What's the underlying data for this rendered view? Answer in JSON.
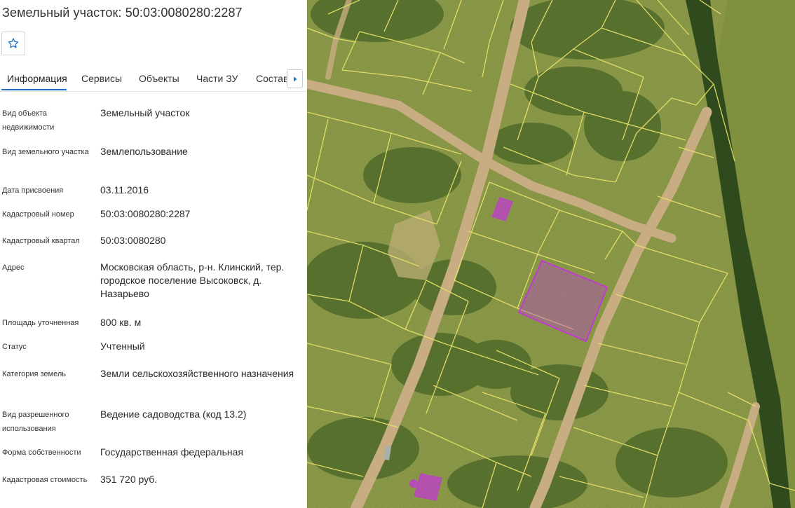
{
  "title": "Земельный участок: 50:03:0080280:2287",
  "favorite": {
    "icon": "star-outline-icon"
  },
  "tabs": [
    {
      "label": "Информация",
      "active": true
    },
    {
      "label": "Сервисы",
      "active": false
    },
    {
      "label": "Объекты",
      "active": false
    },
    {
      "label": "Части ЗУ",
      "active": false
    },
    {
      "label": "Составы",
      "active": false
    }
  ],
  "tab_scroll_icon": "caret-right-icon",
  "fields": [
    {
      "label": "Вид объекта недвижимости",
      "value": "Земельный участок"
    },
    {
      "label": "Вид земельного участка",
      "value": "Землепользование"
    },
    {
      "label": "Дата присвоения",
      "value": "03.11.2016"
    },
    {
      "label": "Кадастровый номер",
      "value": "50:03:0080280:2287"
    },
    {
      "label": "Кадастровый квартал",
      "value": "50:03:0080280"
    },
    {
      "label": "Адрес",
      "value": "Московская область, р-н. Клинский, тер. городское поселение Высоковск, д. Назарьево"
    },
    {
      "label": "Площадь уточненная",
      "value": "800 кв. м"
    },
    {
      "label": "Статус",
      "value": "Учтенный"
    },
    {
      "label": "Категория земель",
      "value": "Земли сельскохозяйственного назначения"
    },
    {
      "label": "Вид разрешенного использования",
      "value": "Ведение садоводства (код 13.2)"
    },
    {
      "label": "Форма собственности",
      "value": "Государственная федеральная"
    },
    {
      "label": "Кадастровая стоимость",
      "value": "351 720 руб."
    }
  ],
  "map": {
    "type": "satellite cadastral map",
    "parcel_boundary_color": "#e6e06a",
    "selected_parcel_color": "#c23bd0",
    "road_color": "#c9ad82"
  }
}
